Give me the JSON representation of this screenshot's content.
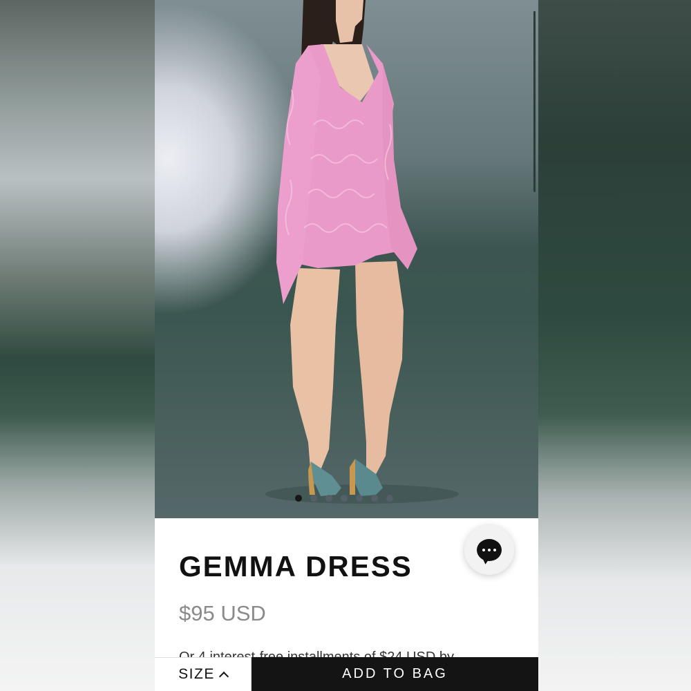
{
  "product": {
    "title": "GEMMA DRESS",
    "price": "$95 USD",
    "installments_text": "Or 4 interest-free installments of $24 USD by"
  },
  "carousel": {
    "image_alt": "Model wearing pink lace mini dress with bell sleeves",
    "total_slides": 7,
    "active_slide": 1
  },
  "chat": {
    "icon": "chat-icon"
  },
  "actions": {
    "size_label": "SIZE",
    "add_to_bag_label": "ADD TO BAG"
  },
  "colors": {
    "dress_pink": "#e99ac8",
    "button_dark": "#141414",
    "price_gray": "#8a8a8a"
  }
}
